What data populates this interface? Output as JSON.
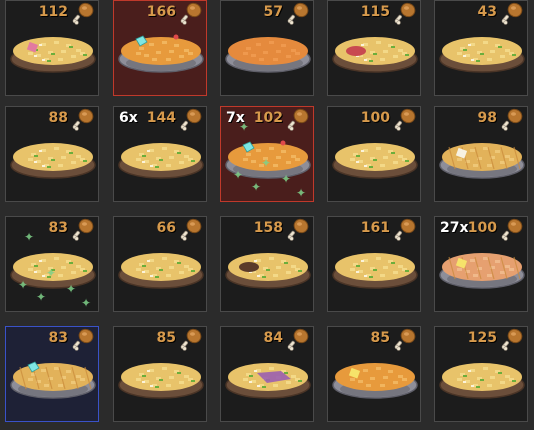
{
  "colors": {
    "food_value": "#d79a4c",
    "selected_red_border": "#c0392b",
    "selected_red_bg": "#4a1e1c",
    "selected_blue_border": "#3a52c8",
    "slot_border": "#4a4a4a"
  },
  "icons": {
    "hunger": "drumstick-icon",
    "item": "pie-icon",
    "effect": "sparkle-icon"
  },
  "rows": [
    [
      {
        "value": "112",
        "count": "",
        "style": "veg",
        "select": "",
        "gem": false,
        "accent": "pink"
      },
      {
        "value": "166",
        "count": "",
        "style": "orange-pie",
        "select": "red",
        "gem": true,
        "accent": ""
      },
      {
        "value": "57",
        "count": "",
        "style": "pumpkin",
        "select": "",
        "gem": false,
        "accent": ""
      },
      {
        "value": "115",
        "count": "",
        "style": "veg",
        "select": "",
        "gem": false,
        "accent": "red"
      },
      {
        "value": "43",
        "count": "",
        "style": "veg",
        "select": "",
        "gem": false,
        "accent": ""
      }
    ],
    [
      {
        "value": "88",
        "count": "",
        "style": "veg",
        "select": "",
        "gem": false,
        "accent": ""
      },
      {
        "value": "144",
        "count": "6x",
        "style": "veg",
        "select": "",
        "gem": false,
        "accent": ""
      },
      {
        "value": "102",
        "count": "7x",
        "style": "orange-pie",
        "select": "red",
        "gem": true,
        "accent": "",
        "sparkles": true
      },
      {
        "value": "100",
        "count": "",
        "style": "veg",
        "select": "",
        "gem": false,
        "accent": ""
      },
      {
        "value": "98",
        "count": "",
        "style": "lattice",
        "select": "",
        "gem": false,
        "accent": "white"
      }
    ],
    [
      {
        "value": "83",
        "count": "",
        "style": "veg",
        "select": "",
        "gem": false,
        "accent": "",
        "sparkles": true
      },
      {
        "value": "66",
        "count": "",
        "style": "veg",
        "select": "",
        "gem": false,
        "accent": ""
      },
      {
        "value": "158",
        "count": "",
        "style": "veg",
        "select": "",
        "gem": false,
        "accent": "dark"
      },
      {
        "value": "161",
        "count": "",
        "style": "veg",
        "select": "",
        "gem": false,
        "accent": ""
      },
      {
        "value": "100",
        "count": "27x",
        "style": "peach-pie",
        "select": "",
        "gem": false,
        "accent": "yellow"
      }
    ],
    [
      {
        "value": "83",
        "count": "",
        "style": "lattice",
        "select": "blue",
        "gem": true,
        "accent": ""
      },
      {
        "value": "85",
        "count": "",
        "style": "veg",
        "select": "",
        "gem": false,
        "accent": ""
      },
      {
        "value": "84",
        "count": "",
        "style": "veg",
        "select": "",
        "gem": false,
        "accent": "purple"
      },
      {
        "value": "85",
        "count": "",
        "style": "orange-pie",
        "select": "",
        "gem": false,
        "accent": "yellow"
      },
      {
        "value": "125",
        "count": "",
        "style": "veg",
        "select": "",
        "gem": false,
        "accent": ""
      }
    ]
  ]
}
